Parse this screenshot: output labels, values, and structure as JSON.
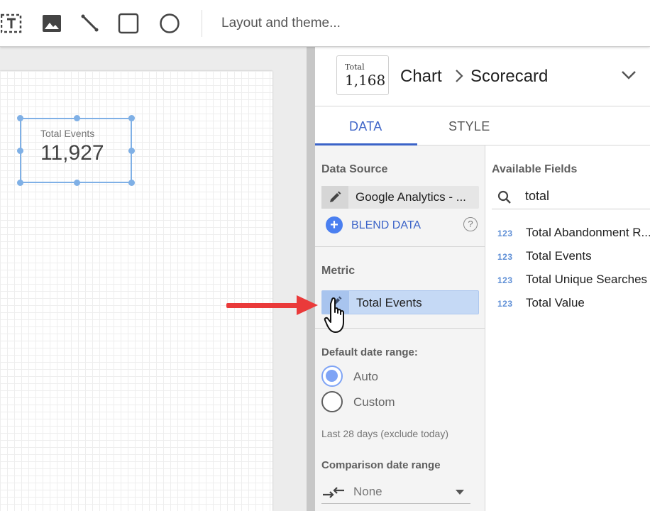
{
  "toolbar": {
    "icons": [
      "text-icon",
      "image-icon",
      "line-icon",
      "rectangle-icon",
      "circle-icon"
    ],
    "layout_label": "Layout and theme..."
  },
  "canvas": {
    "scorecard": {
      "label": "Total Events",
      "value": "11,927"
    }
  },
  "panel": {
    "thumb": {
      "label": "Total",
      "value": "1,168"
    },
    "breadcrumb": {
      "parent": "Chart",
      "current": "Scorecard"
    },
    "tabs": [
      {
        "label": "DATA",
        "active": true
      },
      {
        "label": "STYLE",
        "active": false
      }
    ],
    "data_source": {
      "label": "Data Source",
      "value": "Google Analytics - ...",
      "blend_label": "BLEND DATA"
    },
    "metric": {
      "label": "Metric",
      "value": "Total Events"
    },
    "date_range": {
      "label": "Default date range:",
      "options": [
        {
          "label": "Auto",
          "selected": true
        },
        {
          "label": "Custom",
          "selected": false
        }
      ],
      "note": "Last 28 days (exclude today)"
    },
    "comparison": {
      "label": "Comparison date range",
      "value": "None"
    },
    "available_fields": {
      "label": "Available Fields",
      "search_value": "total",
      "items": [
        {
          "type": "123",
          "name": "Total Abandonment R..."
        },
        {
          "type": "123",
          "name": "Total Events"
        },
        {
          "type": "123",
          "name": "Total Unique Searches"
        },
        {
          "type": "123",
          "name": "Total Value"
        }
      ]
    }
  },
  "colors": {
    "accent_blue": "#3b63c8",
    "selection_blue": "#7fb0e6",
    "metric_chip": "#c5d9f5",
    "annotation_red": "#ea3a3a"
  }
}
